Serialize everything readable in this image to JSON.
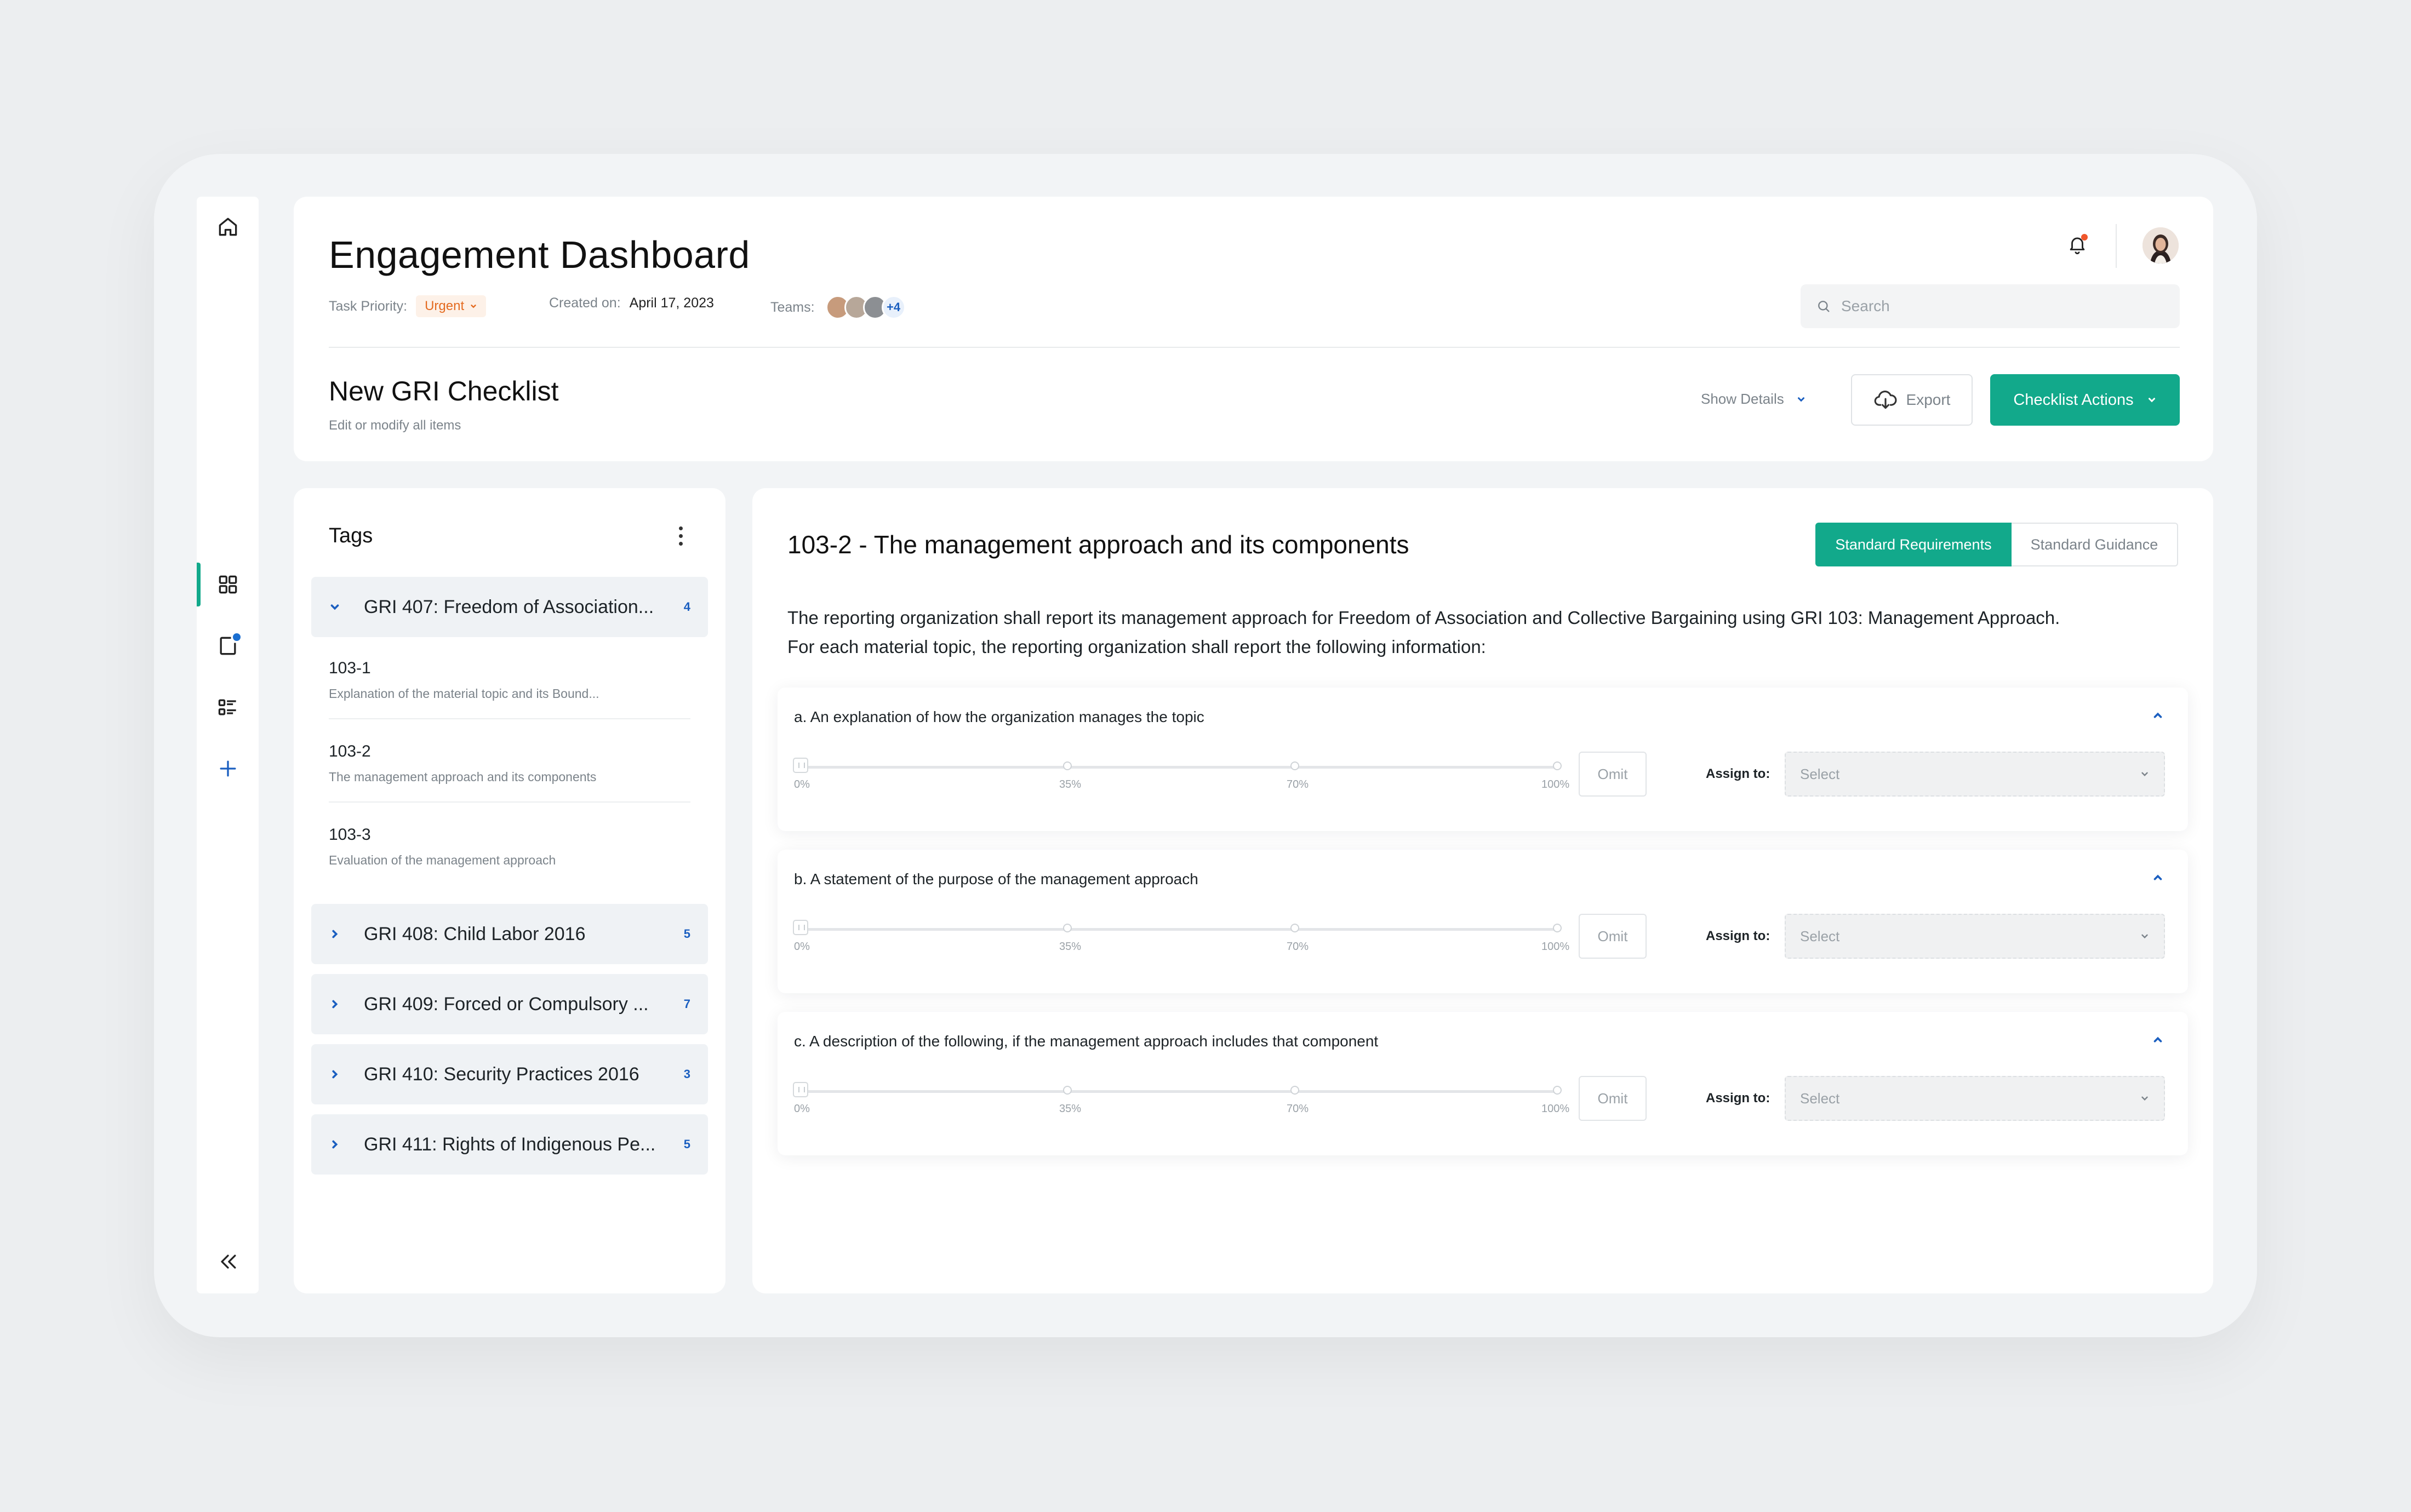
{
  "header": {
    "title": "Engagement Dashboard",
    "priority_label": "Task Priority:",
    "priority_value": "Urgent",
    "created_label": "Created on:",
    "created_value": "April 17, 2023",
    "teams_label": "Teams:",
    "teams_more": "+4",
    "search_placeholder": "Search"
  },
  "checklist": {
    "title": "New GRI Checklist",
    "subtitle": "Edit or modify all items",
    "show_details": "Show Details",
    "export": "Export",
    "actions": "Checklist Actions"
  },
  "tags": {
    "title": "Tags",
    "groups": [
      {
        "name": "GRI 407: Freedom of Association...",
        "count": "4",
        "expanded": true
      },
      {
        "name": "GRI 408: Child Labor 2016",
        "count": "5",
        "expanded": false
      },
      {
        "name": "GRI 409: Forced or Compulsory ...",
        "count": "7",
        "expanded": false
      },
      {
        "name": "GRI 410: Security Practices 2016",
        "count": "3",
        "expanded": false
      },
      {
        "name": "GRI 411: Rights of Indigenous Pe...",
        "count": "5",
        "expanded": false
      }
    ],
    "items": [
      {
        "code": "103-1",
        "desc": "Explanation of the material topic and its Bound..."
      },
      {
        "code": "103-2",
        "desc": "The management approach and its components"
      },
      {
        "code": "103-3",
        "desc": "Evaluation of the management approach"
      }
    ]
  },
  "main": {
    "title": "103-2 - The management approach and its components",
    "tab_requirements": "Standard Requirements",
    "tab_guidance": "Standard Guidance",
    "intro_line1": "The reporting organization shall report its management approach for Freedom of Association and Collective Bargaining using GRI 103: Management Approach.",
    "intro_line2": "For each material topic, the reporting organization shall report the following information:",
    "slider_labels": [
      "0%",
      "35%",
      "70%",
      "100%"
    ],
    "omit": "Omit",
    "assign_label": "Assign to:",
    "select_placeholder": "Select",
    "requirements": [
      {
        "text": "a. An explanation of how the organization manages the topic",
        "progress": 0
      },
      {
        "text": "b. A statement of the purpose of the management approach",
        "progress": 0
      },
      {
        "text": "c. A description of the following, if the management approach includes that component",
        "progress": 0
      }
    ]
  },
  "colors": {
    "accent": "#12a98b",
    "link": "#1b5fc0",
    "urgent": "#e46a1f"
  },
  "icons": [
    "home-icon",
    "grid-icon",
    "document-icon",
    "list-icon",
    "plus-icon",
    "collapse-icon",
    "bell-icon",
    "search-icon",
    "cloud-download-icon",
    "chevron-down-icon",
    "chevron-right-icon",
    "chevron-up-icon",
    "kebab-icon"
  ]
}
